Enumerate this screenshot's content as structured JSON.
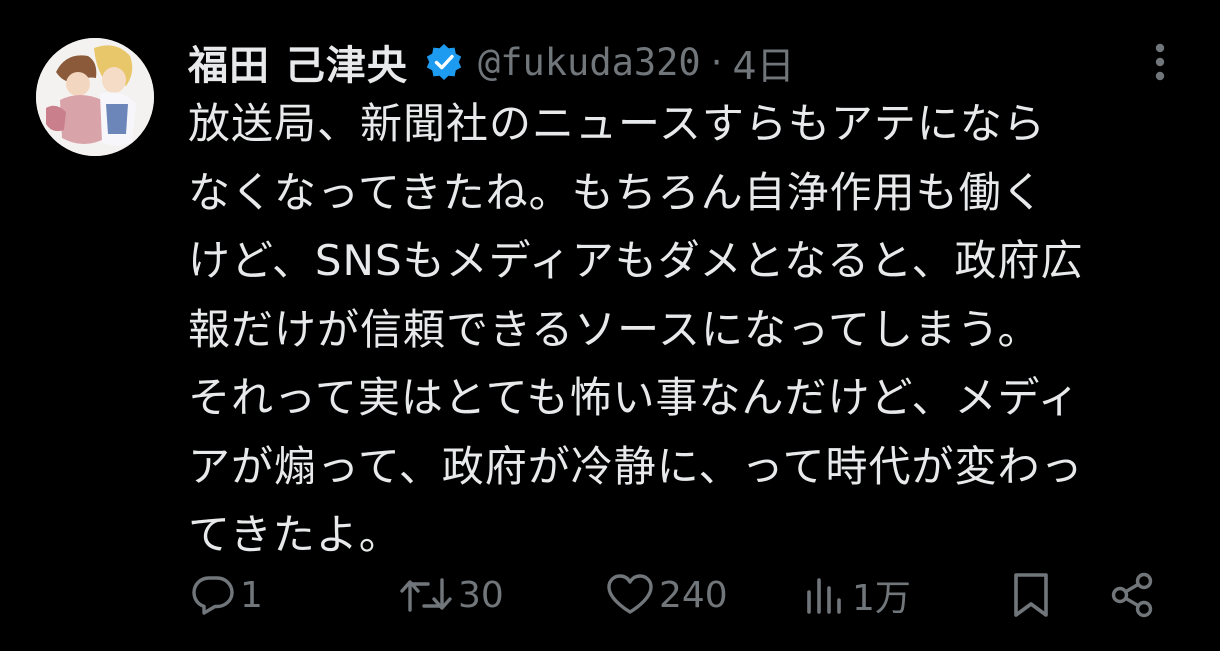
{
  "tweet": {
    "author": {
      "display_name": "福田 己津央",
      "handle": "@fukuda320",
      "verified": true
    },
    "separator": "·",
    "time": "4日",
    "text_lines": [
      "放送局、新聞社のニュースすらもアテになら",
      "なくなってきたね。もちろん自浄作用も働く",
      "けど、SNSもメディアもダメとなると、政府広",
      "報だけが信頼できるソースになってしまう。",
      "それって実はとても怖い事なんだけど、メディ",
      "アが煽って、政府が冷静に、って時代が変わっ",
      "てきたよ。"
    ],
    "actions": {
      "replies": "1",
      "retweets": "30",
      "likes": "240",
      "views": "1万"
    }
  },
  "colors": {
    "background": "#000000",
    "text": "#e7e9ea",
    "muted": "#71767b",
    "verified_badge": "#1d9bf0"
  },
  "icons": {
    "reply": "reply-icon",
    "retweet": "retweet-icon",
    "like": "heart-icon",
    "views": "views-icon",
    "bookmark": "bookmark-icon",
    "share": "share-icon",
    "more": "more-icon",
    "verified": "verified-badge-icon"
  }
}
